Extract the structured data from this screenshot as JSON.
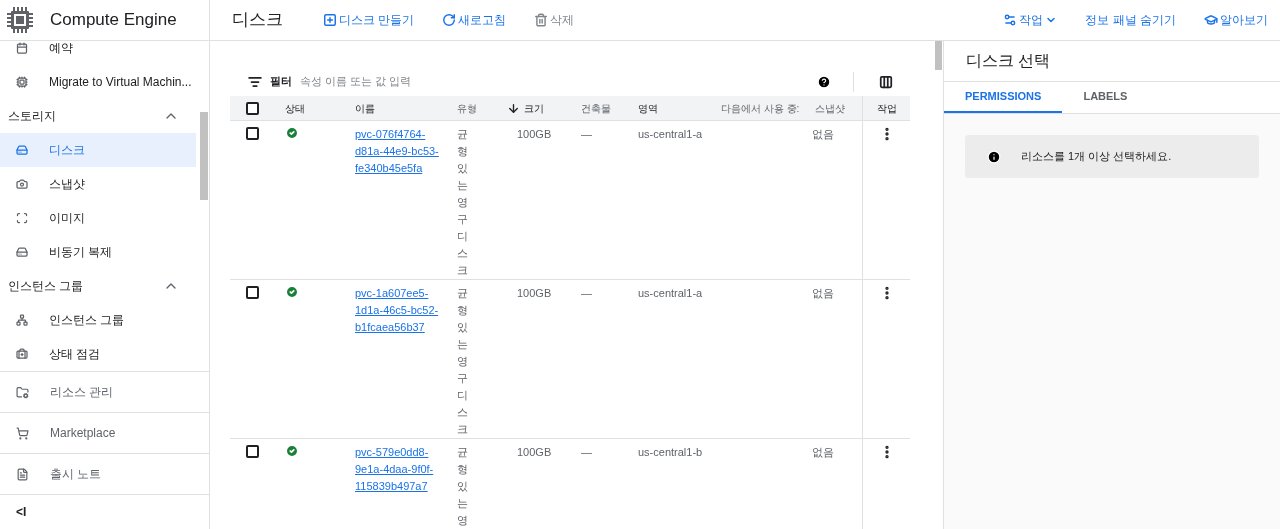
{
  "app": {
    "title": "Compute Engine"
  },
  "sidebar": {
    "items": [
      {
        "kind": "item",
        "label": "예약",
        "selected": false
      },
      {
        "kind": "item",
        "label": "Migrate to Virtual Machin...",
        "selected": false
      },
      {
        "kind": "section",
        "label": "스토리지",
        "expanded": true
      },
      {
        "kind": "item",
        "label": "디스크",
        "selected": true
      },
      {
        "kind": "item",
        "label": "스냅샷",
        "selected": false
      },
      {
        "kind": "item",
        "label": "이미지",
        "selected": false
      },
      {
        "kind": "item",
        "label": "비동기 복제",
        "selected": false
      },
      {
        "kind": "section",
        "label": "인스턴스 그룹",
        "expanded": true
      },
      {
        "kind": "item",
        "label": "인스턴스 그룹",
        "selected": false
      },
      {
        "kind": "item",
        "label": "상태 점검",
        "selected": false
      }
    ],
    "footer": [
      "리소스 관리",
      "Marketplace",
      "출시 노트"
    ],
    "collapse": "<I"
  },
  "page_title": "디스크",
  "toolbar": [
    {
      "kind": "create",
      "label": "디스크 만들기",
      "disabled": false
    },
    {
      "kind": "refresh",
      "label": "새로고침",
      "disabled": false
    },
    {
      "kind": "delete",
      "label": "삭제",
      "disabled": true
    }
  ],
  "header_actions": [
    {
      "kind": "actions",
      "label": "작업"
    },
    {
      "kind": "hide",
      "label": "정보 패널 숨기기"
    },
    {
      "kind": "learn",
      "label": "알아보기"
    }
  ],
  "filter": {
    "label": "필터",
    "placeholder": "속성 이름 또는 값 입력"
  },
  "table": {
    "select_all_checked": false,
    "columns": [
      {
        "label": "상태",
        "sorted": false
      },
      {
        "label": "이름",
        "sorted": false
      },
      {
        "label": "유형",
        "sorted": false
      },
      {
        "label": "크기",
        "sorted": true
      },
      {
        "label": "건축물",
        "sorted": false
      },
      {
        "label": "영역",
        "sorted": false
      },
      {
        "label": "다음에서 사용 중:",
        "sorted": false
      },
      {
        "label": "스냅샷",
        "sorted": false
      },
      {
        "label": "작업",
        "sorted": false
      }
    ],
    "rows": [
      {
        "selected": false,
        "healthy": true,
        "name": "pvc-076f4764-d81a-44e9-bc53-fe340b45e5fa",
        "type": "균형 있는 영구 디스크",
        "size": "100GB",
        "architecture": "—",
        "zone": "us-central1-a",
        "snapshot": "없음"
      },
      {
        "selected": false,
        "healthy": true,
        "name": "pvc-1a607ee5-1d1a-46c5-bc52-b1fcaea56b37",
        "type": "균형 있는 영구 디스크",
        "size": "100GB",
        "architecture": "—",
        "zone": "us-central1-a",
        "snapshot": "없음"
      },
      {
        "selected": false,
        "healthy": true,
        "name": "pvc-579e0dd8-9e1a-4daa-9f0f-115839b497a7",
        "type": "균형 있는 영",
        "size": "100GB",
        "architecture": "—",
        "zone": "us-central1-b",
        "snapshot": "없음"
      }
    ]
  },
  "info_panel": {
    "title": "디스크 선택",
    "tabs": [
      {
        "label": "PERMISSIONS",
        "selected": true
      },
      {
        "label": "LABELS",
        "selected": false
      }
    ],
    "message": "리소스를 1개 이상 선택하세요."
  }
}
